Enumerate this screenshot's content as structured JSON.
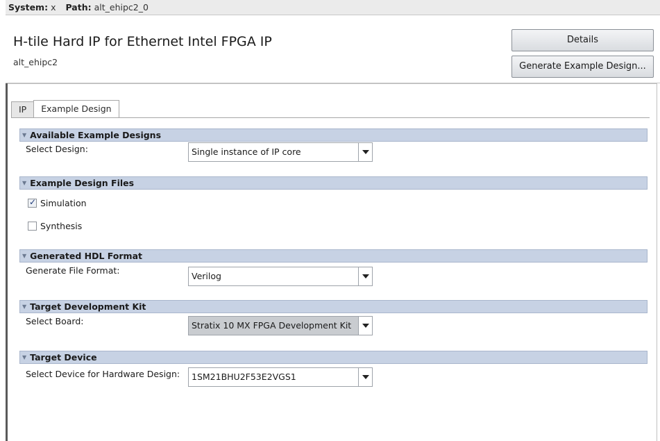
{
  "topbar": {
    "system_key": "System:",
    "system_value": "x",
    "path_key": "Path:",
    "path_value": "alt_ehipc2_0"
  },
  "header": {
    "title": "H-tile Hard IP for Ethernet Intel FPGA IP",
    "subtitle": "alt_ehipc2",
    "details_button": "Details",
    "generate_button": "Generate Example Design..."
  },
  "tabs": [
    "IP",
    "Example Design"
  ],
  "active_tab": "Example Design",
  "sections": {
    "available": {
      "title": "Available Example Designs",
      "label": "Select Design:",
      "value": "Single instance of IP core"
    },
    "files": {
      "title": "Example Design Files",
      "simulation_label": "Simulation",
      "simulation_checked": true,
      "synthesis_label": "Synthesis",
      "synthesis_checked": false
    },
    "hdl": {
      "title": "Generated HDL Format",
      "label": "Generate File Format:",
      "value": "Verilog"
    },
    "kit": {
      "title": "Target Development Kit",
      "label": "Select Board:",
      "value": "Stratix 10 MX FPGA Development Kit"
    },
    "device": {
      "title": "Target Device",
      "label": "Select Device for Hardware Design:",
      "value": "1SM21BHU2F53E2VGS1"
    }
  },
  "colors": {
    "section_header": "#c7d2e4",
    "selected_combo": "#c9ccd0"
  }
}
